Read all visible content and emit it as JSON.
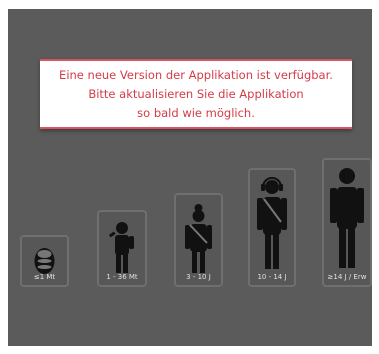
{
  "notice": {
    "line1": "Eine neue Version der Applikation ist verfügbar.",
    "line2": "Bitte aktualisieren Sie die Applikation",
    "line3": "so bald wie möglich."
  },
  "age_groups": [
    {
      "label": "≤1 Mt",
      "icon": "baby-seat-icon"
    },
    {
      "label": "1 - 36 Mt",
      "icon": "toddler-icon"
    },
    {
      "label": "3 - 10 J",
      "icon": "child-icon"
    },
    {
      "label": "10 - 14 J",
      "icon": "teen-icon"
    },
    {
      "label": "≥14 J / Erw",
      "icon": "adult-icon"
    }
  ],
  "colors": {
    "accent": "#d9545e",
    "text_red": "#d53b47",
    "backdrop": "#5b5b5b",
    "figure": "#111111"
  }
}
